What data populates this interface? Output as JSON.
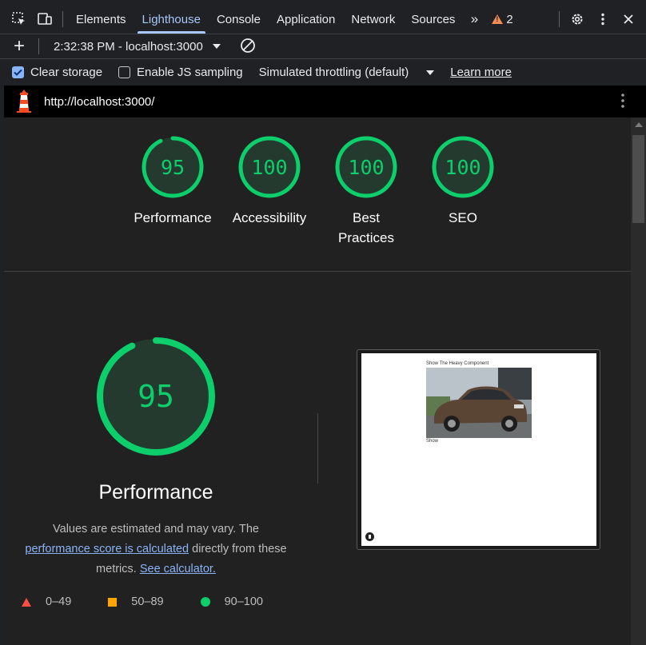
{
  "tabs": [
    {
      "label": "Elements"
    },
    {
      "label": "Lighthouse"
    },
    {
      "label": "Console"
    },
    {
      "label": "Application"
    },
    {
      "label": "Network"
    },
    {
      "label": "Sources"
    }
  ],
  "active_tab": "Lighthouse",
  "warnings_count": "2",
  "report_selector": {
    "value": "2:32:38 PM - localhost:3000"
  },
  "options": {
    "clear_storage": {
      "label": "Clear storage",
      "checked": true
    },
    "js_sampling": {
      "label": "Enable JS sampling",
      "checked": false
    },
    "throttling": {
      "label": "Simulated throttling (default)"
    },
    "learn_more": "Learn more"
  },
  "url": "http://localhost:3000/",
  "categories": [
    {
      "score": "95",
      "label": "Performance"
    },
    {
      "score": "100",
      "label": "Accessibility"
    },
    {
      "score": "100",
      "label_line1": "Best",
      "label_line2": "Practices"
    },
    {
      "score": "100",
      "label": "SEO"
    }
  ],
  "performance": {
    "score": "95",
    "title": "Performance",
    "desc_1": "Values are estimated and may vary. The",
    "desc_link": "performance score is calculated",
    "desc_2": "directly from these",
    "desc_3": "metrics.",
    "calc_link": "See calculator."
  },
  "legend": [
    {
      "label": "0–49"
    },
    {
      "label": "50–89"
    },
    {
      "label": "90–100"
    }
  ],
  "screenshot": {
    "heading": "Show The Heavy Component",
    "caption": "Show"
  },
  "colors": {
    "pass": "#0cce6b",
    "average": "#ffa400",
    "fail": "#ff4e42",
    "accent": "#a8c7fa"
  }
}
